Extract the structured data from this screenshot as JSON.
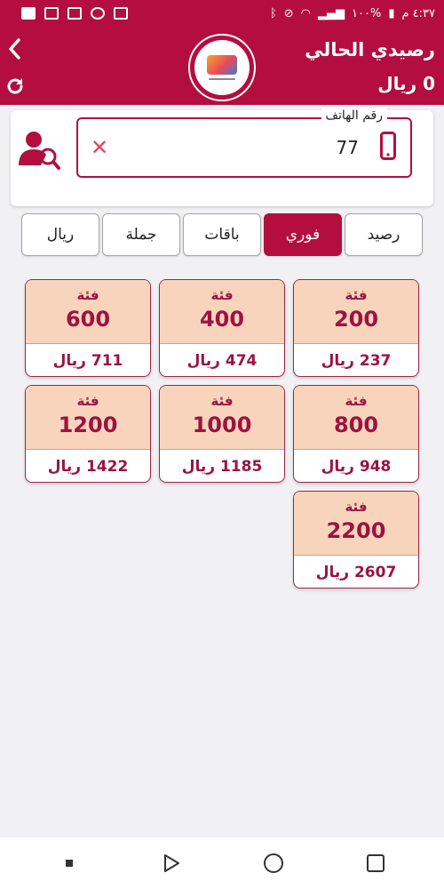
{
  "status_bar": {
    "time": "٤:٣٧ م",
    "battery": "١٠٠%"
  },
  "header": {
    "balance_title": "رصيدي الحالي",
    "balance_value": "0 ريال"
  },
  "phone_field": {
    "label": "رقم الهاتف",
    "value": "77",
    "clear_glyph": "✕"
  },
  "tabs": [
    {
      "label": "رصيد",
      "active": false
    },
    {
      "label": "فوري",
      "active": true
    },
    {
      "label": "باقات",
      "active": false
    },
    {
      "label": "جملة",
      "active": false
    },
    {
      "label": "ريال",
      "active": false
    }
  ],
  "cards": [
    {
      "label": "فئة",
      "amount": "200",
      "price": "237 ريال"
    },
    {
      "label": "فئة",
      "amount": "400",
      "price": "474 ريال"
    },
    {
      "label": "فئة",
      "amount": "600",
      "price": "711 ريال"
    },
    {
      "label": "فئة",
      "amount": "800",
      "price": "948 ريال"
    },
    {
      "label": "فئة",
      "amount": "1000",
      "price": "1185 ريال"
    },
    {
      "label": "فئة",
      "amount": "1200",
      "price": "1422 ريال"
    },
    {
      "label": "فئة",
      "amount": "2200",
      "price": "2607 ريال"
    }
  ],
  "colors": {
    "brand": "#b30e3f",
    "card_top": "#f8d4bc",
    "card_text": "#9c1340",
    "clear_x": "#e0455a"
  },
  "icons": {
    "back": "chevron-left-icon",
    "refresh": "refresh-icon",
    "contact_search": "contact-search-icon",
    "clear": "close-icon",
    "phone": "mobile-phone-icon",
    "nav_recent": "square-icon",
    "nav_home": "circle-icon",
    "nav_back": "triangle-icon"
  }
}
